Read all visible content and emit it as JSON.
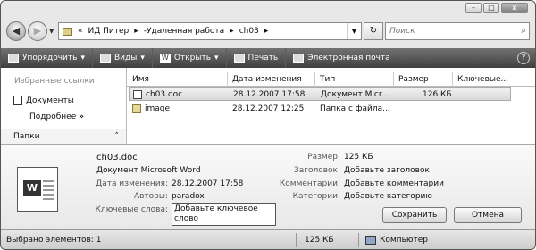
{
  "window": {
    "caption_buttons": [
      "–",
      "□",
      "x"
    ]
  },
  "address": {
    "segments": [
      "«",
      "ИД Питер",
      "-Удаленная работа",
      "ch03"
    ],
    "separators": [
      "▸",
      "▸",
      "▸",
      "▸"
    ],
    "refresh_icon": "refresh-icon",
    "search_placeholder": "Поиск"
  },
  "toolbar": {
    "organize": "Упорядочить",
    "views": "Виды",
    "open": "Открыть",
    "print": "Печать",
    "email": "Электронная почта",
    "help": "?"
  },
  "navpane": {
    "favorites_title": "Избранные ссылки",
    "documents": "Документы",
    "more": "Подробнее",
    "more_chevron": "»",
    "folders": "Папки",
    "folders_chevron": "˄"
  },
  "columns": [
    "Имя",
    "Дата изменения",
    "Тип",
    "Размер",
    "Ключевые..."
  ],
  "files": [
    {
      "name": "ch03.doc",
      "date": "28.12.2007 17:58",
      "type": "Документ Micr...",
      "size": "126 КБ",
      "icon": "word-document-icon",
      "selected": true
    },
    {
      "name": "image",
      "date": "28.12.2007 12:25",
      "type": "Папка с файла...",
      "size": "",
      "icon": "folder-icon",
      "selected": false
    }
  ],
  "details": {
    "filename": "ch03.doc",
    "filetype": "Документ Microsoft Word",
    "date_label": "Дата изменения:",
    "date_value": "28.12.2007 17:58",
    "authors_label": "Авторы:",
    "authors_value": "paradox",
    "keywords_label": "Ключевые слова:",
    "keywords_value": "Добавьте ключевое слово",
    "size_label": "Размер:",
    "size_value": "125 КБ",
    "title_label": "Заголовок:",
    "title_value": "Добавьте заголовок",
    "comments_label": "Комментарии:",
    "comments_value": "Добавьте комментарии",
    "categories_label": "Категории:",
    "categories_value": "Добавьте категорию",
    "save_label": "Сохранить",
    "cancel_label": "Отмена"
  },
  "status": {
    "selected": "Выбрано элементов: 1",
    "size": "125 КБ",
    "location": "Компьютер"
  }
}
